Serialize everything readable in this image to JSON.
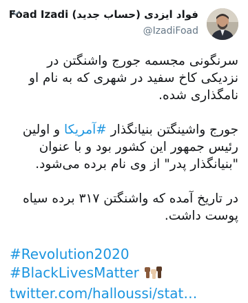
{
  "tweet": {
    "author": {
      "display_name": "فواد ایزدی (حساب جدید) Foad Izadi",
      "handle": "@IzadiFoad"
    },
    "paragraphs": [
      "سرنگونی مجسمه جورج واشنگتن در نزدیکی کاخ سفید در شهری که به نام او نامگذاری شده.",
      "در تاریخ آمده که واشنگتن ۳۱۷ برده سیاه پوست داشت."
    ],
    "paragraph2": {
      "before_hashtag": "جورج واشینگتن بنیانگذار ",
      "hashtag": "#آمریکا",
      "after_hashtag": " و اولین رئیس جمهور این کشور بود و با عنوان \"بنیانگذار پدر\" از وی نام برده می‌شود."
    },
    "hashtags": [
      "#Revolution2020",
      "#BlackLivesMatter"
    ],
    "link": "twitter.com/halloussi/stat…"
  },
  "icons": {
    "menu": "chevron-down-icon",
    "avatar": "avatar",
    "emoji": "raised-fists-icon"
  },
  "colors": {
    "link": "#1b95e0",
    "text": "#14171a",
    "secondary": "#657786"
  }
}
